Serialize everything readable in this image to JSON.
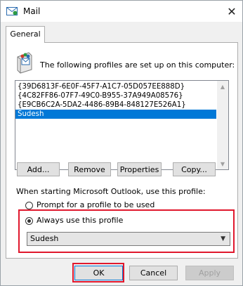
{
  "window": {
    "title": "Mail",
    "close_glyph": "✕"
  },
  "tabs": [
    {
      "label": "General",
      "active": true
    }
  ],
  "intro_text": "The following profiles are set up on this computer:",
  "profiles": [
    {
      "label": "{39D6813F-6E0F-45F7-A1C7-05D057EE888D}",
      "selected": false
    },
    {
      "label": "{4C82FF86-07F7-49C0-B955-37A949A08576}",
      "selected": false
    },
    {
      "label": "{E9CB6C2A-5DA2-4486-89B4-848127E526A1}",
      "selected": false
    },
    {
      "label": "Sudesh",
      "selected": true
    }
  ],
  "profile_buttons": {
    "add": "Add...",
    "remove": "Remove",
    "properties": "Properties",
    "copy": "Copy..."
  },
  "startup": {
    "label": "When starting Microsoft Outlook, use this profile:",
    "prompt_option": "Prompt for a profile to be used",
    "always_option": "Always use this profile",
    "selected_option": "always",
    "always_profile_value": "Sudesh"
  },
  "dialog_buttons": {
    "ok": "OK",
    "cancel": "Cancel",
    "apply": "Apply",
    "apply_enabled": false
  },
  "colors": {
    "accent": "#0078d7",
    "highlight_annotation": "#e0182d"
  },
  "icons": {
    "title": "mail-profile-icon",
    "profiles": "mail-profile-icon",
    "close": "close-icon",
    "dropdown": "chevron-down-icon"
  }
}
